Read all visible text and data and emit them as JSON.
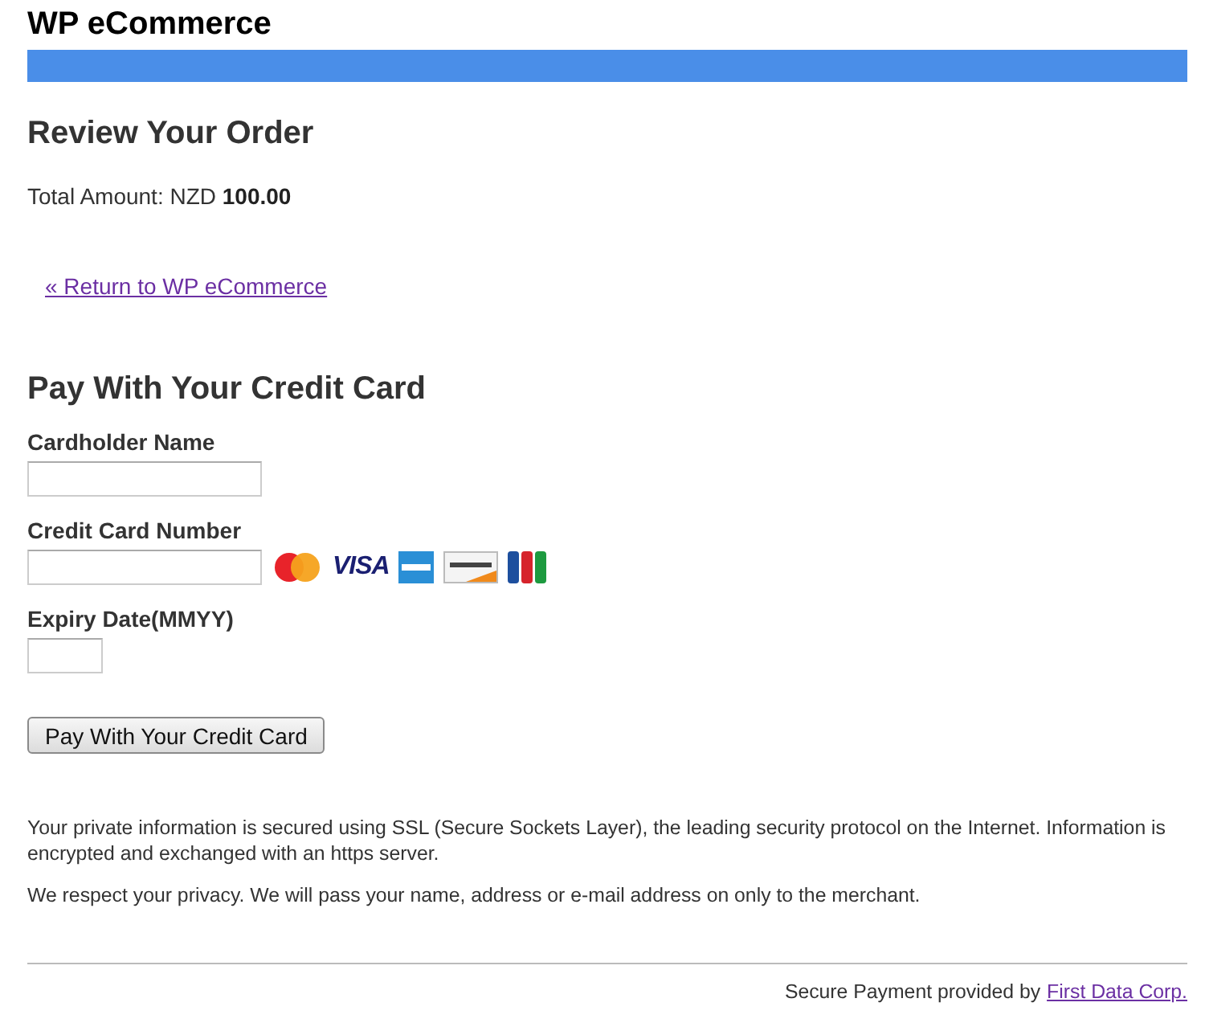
{
  "site_title": "WP eCommerce",
  "review": {
    "heading": "Review Your Order",
    "total_label": "Total Amount: NZD",
    "total_value": "100.00",
    "return_link": "« Return to WP eCommerce"
  },
  "payment": {
    "heading": "Pay With Your Credit Card",
    "fields": [
      {
        "label": "Cardholder Name",
        "kind": "long"
      },
      {
        "label": "Credit Card Number",
        "kind": "long"
      },
      {
        "label": "Expiry Date(MMYY)",
        "kind": "short"
      }
    ],
    "cards": [
      {
        "kind": "mastercard"
      },
      {
        "kind": "visa",
        "label": "VISA"
      },
      {
        "kind": "amex"
      },
      {
        "kind": "discover"
      },
      {
        "kind": "jcb"
      }
    ],
    "submit": "Pay With Your Credit Card"
  },
  "notes": [
    "Your private information is secured using SSL (Secure Sockets Layer), the leading security protocol on the Internet. Information is encrypted and exchanged with an https server.",
    "We respect your privacy. We will pass your name, address or e-mail address on only to the merchant."
  ],
  "footer": {
    "text": "Secure Payment provided by",
    "link": "First Data Corp."
  }
}
